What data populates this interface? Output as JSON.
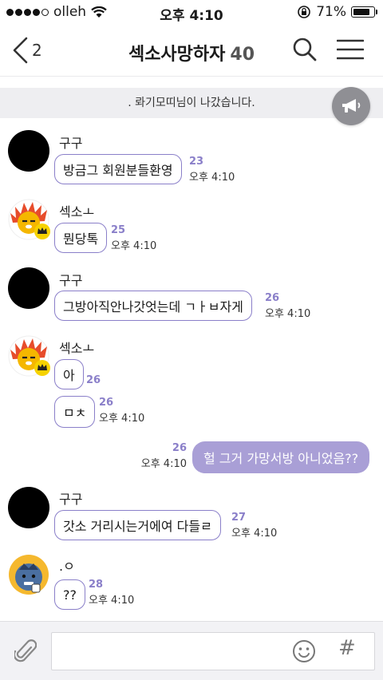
{
  "status_bar": {
    "carrier": "olleh",
    "time": "오후 4:10",
    "battery": "71%"
  },
  "header": {
    "back_count": "2",
    "title": "섹소사망하자",
    "member_count": "40"
  },
  "notice": {
    "text": ". 롸기모띠님이 나갔습니다."
  },
  "messages": [
    {
      "sender": "구구",
      "text": "방금그 회원분들환영",
      "count": "23",
      "time": "오후 4:10"
    },
    {
      "sender": "섹소ㅗ",
      "text": "뭔당톡",
      "count": "25",
      "time": "오후 4:10"
    },
    {
      "sender": "구구",
      "text": "그방아직안나갓엇는데 ㄱㅏㅂ자게",
      "count": "26",
      "time": "오후 4:10"
    },
    {
      "sender": "섹소ㅗ",
      "text": "아",
      "count": "26",
      "time": ""
    },
    {
      "sender": "",
      "text": "ㅁㅊ",
      "count": "26",
      "time": "오후 4:10"
    },
    {
      "sender": "",
      "text": "헐 그거 가망서방 아니었음??",
      "count": "26",
      "time": "오후 4:10"
    },
    {
      "sender": "구구",
      "text": "갓소 거리시는거에여 다들ㄹ",
      "count": "27",
      "time": "오후 4:10"
    },
    {
      "sender": ".ㅇ",
      "text": "??",
      "count": "28",
      "time": "오후 4:10"
    }
  ],
  "composer": {
    "placeholder": "",
    "hash_label": "#"
  },
  "colors": {
    "accent": "#8a7fc9",
    "my_bubble": "#a99fd6",
    "notice_bg": "#eeeef1"
  },
  "icons": [
    "back-chevron-icon",
    "search-icon",
    "menu-icon",
    "megaphone-icon",
    "paperclip-icon",
    "emoji-icon",
    "wifi-icon",
    "lock-rotation-icon",
    "crown-icon"
  ]
}
